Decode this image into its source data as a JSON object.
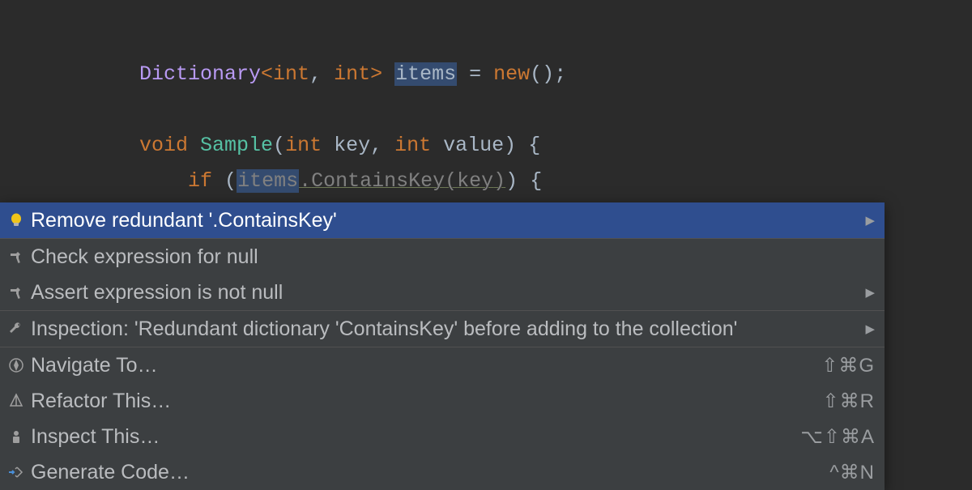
{
  "code": {
    "line1": {
      "dict": "Dictionary",
      "lt": "<",
      "int1": "int",
      "comma": ", ",
      "int2": "int",
      "gt": ">",
      "space": " ",
      "items": "items",
      "eq": " = ",
      "new": "new",
      "parens": "()",
      "semi": ";"
    },
    "line2": {
      "void": "void",
      "sp1": " ",
      "sample": "Sample",
      "open": "(",
      "int1": "int",
      "sp2": " ",
      "key": "key",
      "comma": ", ",
      "int2": "int",
      "sp3": " ",
      "value": "value",
      "close": ")",
      "sp4": " ",
      "brace": "{"
    },
    "line3": {
      "indent": "    ",
      "if": "if",
      "sp1": " ",
      "open": "(",
      "items": "items",
      "dot": ".",
      "contains": "ContainsKey",
      "open2": "(",
      "key": "key",
      "close2": ")",
      "close": ")",
      "sp2": " ",
      "brace": "{"
    }
  },
  "menu": {
    "items": [
      {
        "label": "Remove redundant '.ContainsKey'",
        "hasArrow": true
      },
      {
        "label": "Check expression for null",
        "hasArrow": false
      },
      {
        "label": "Assert expression is not null",
        "hasArrow": true
      },
      {
        "label": "Inspection: 'Redundant dictionary 'ContainsKey' before adding to the collection'",
        "hasArrow": true
      },
      {
        "label": "Navigate To…",
        "shortcut": "⇧⌘G"
      },
      {
        "label": "Refactor This…",
        "shortcut": "⇧⌘R"
      },
      {
        "label": "Inspect This…",
        "shortcut": "⌥⇧⌘A"
      },
      {
        "label": "Generate Code…",
        "shortcut": "^⌘N"
      }
    ]
  }
}
